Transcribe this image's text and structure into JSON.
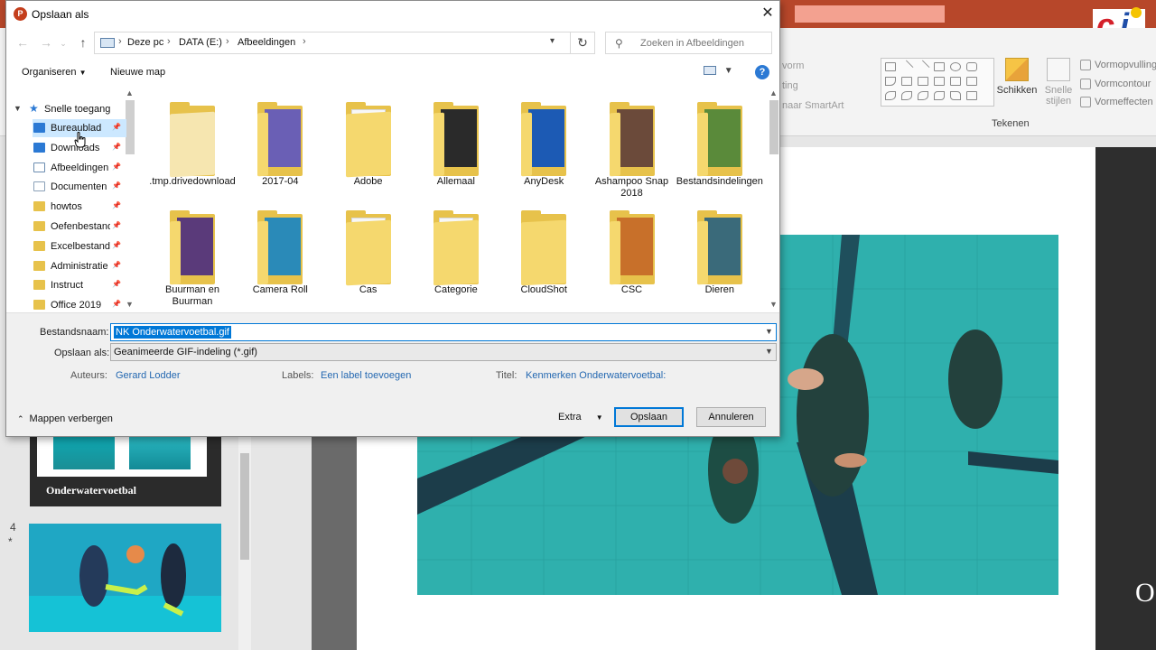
{
  "colors": {
    "accent": "#0078d7",
    "ppt_red": "#b7472a",
    "folder": "#e7c24b"
  },
  "background_app": {
    "ribbon_partials": [
      "vorm",
      "ting",
      "naar SmartArt"
    ],
    "ribbon": {
      "arrange_label": "Schikken",
      "quick_styles_label": "Snelle stijlen",
      "shape_fill": "Vormopvulling",
      "shape_outline": "Vormcontour",
      "shape_effects": "Vormeffecten",
      "group_label": "Tekenen"
    },
    "slide3_caption": "Onderwatervoetbal",
    "slide4_number": "4",
    "slide4_star": "*",
    "right_letter": "O",
    "logo_text": "ci"
  },
  "dialog": {
    "title": "Opslaan als",
    "app_icon": "P",
    "close_icon": "✕",
    "breadcrumbs": [
      "Deze pc",
      "DATA (E:)",
      "Afbeeldingen"
    ],
    "search_placeholder": "Zoeken in Afbeeldingen",
    "toolbar": {
      "organise": "Organiseren",
      "new_folder": "Nieuwe map",
      "help": "?"
    },
    "nav": {
      "quick_access": "Snelle toegang",
      "items": [
        {
          "label": "Bureaublad",
          "icon": "desktop-icon"
        },
        {
          "label": "Downloads",
          "icon": "download-icon"
        },
        {
          "label": "Afbeeldingen",
          "icon": "pictures-icon"
        },
        {
          "label": "Documenten",
          "icon": "documents-icon"
        },
        {
          "label": "howtos",
          "icon": "folder-icon"
        },
        {
          "label": "Oefenbestanden",
          "icon": "folder-icon"
        },
        {
          "label": "Excelbestanden",
          "icon": "folder-icon"
        },
        {
          "label": "Administratie",
          "icon": "folder-icon"
        },
        {
          "label": "Instruct",
          "icon": "folder-icon"
        },
        {
          "label": "Office 2019",
          "icon": "folder-icon"
        }
      ]
    },
    "files": [
      {
        "name": ".tmp.drivedownload",
        "pic": "none"
      },
      {
        "name": "2017-04",
        "pic": "#6a5fb5"
      },
      {
        "name": "Adobe",
        "pic": "paper"
      },
      {
        "name": "Allemaal",
        "pic": "#2a2a2a"
      },
      {
        "name": "AnyDesk",
        "pic": "#1c5ab4"
      },
      {
        "name": "Ashampoo Snap 2018",
        "pic": "#6b4a3a"
      },
      {
        "name": "Bestandsindelingen",
        "pic": "#5a8a3a"
      },
      {
        "name": "Buurman en Buurman",
        "pic": "#5a3a7a"
      },
      {
        "name": "Camera Roll",
        "pic": "#2a8ab8"
      },
      {
        "name": "Cas",
        "pic": "paper"
      },
      {
        "name": "Categorie",
        "pic": "paper"
      },
      {
        "name": "CloudShot",
        "pic": "none"
      },
      {
        "name": "CSC",
        "pic": "#c8702a"
      },
      {
        "name": "Dieren",
        "pic": "#3a6a7a"
      }
    ],
    "form": {
      "filename_label": "Bestandsnaam:",
      "filename_value": "NK Onderwatervoetbal.gif",
      "type_label": "Opslaan als:",
      "type_value": "Geanimeerde GIF-indeling (*.gif)",
      "authors_label": "Auteurs:",
      "authors_value": "Gerard Lodder",
      "labels_label": "Labels:",
      "labels_value": "Een label toevoegen",
      "title_label": "Titel:",
      "title_value": "Kenmerken Onderwatervoetbal:",
      "hide_folders": "Mappen verbergen",
      "extra": "Extra",
      "save": "Opslaan",
      "cancel": "Annuleren"
    }
  }
}
